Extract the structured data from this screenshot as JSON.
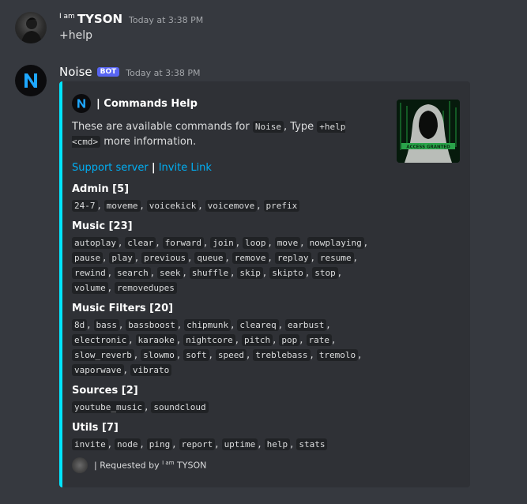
{
  "user_message": {
    "username_prefix": "I am",
    "username": "TYSON",
    "timestamp": "Today at 3:38 PM",
    "content": "+help"
  },
  "bot_message": {
    "botname": "Noise",
    "bot_tag": "BOT",
    "timestamp": "Today at 3:38 PM",
    "embed": {
      "accent_color": "#00e5ff",
      "author": "| Commands Help",
      "desc_pre": "These are available commands for ",
      "desc_code1": "Noise",
      "desc_mid": ", Type ",
      "desc_code2": "+help <cmd>",
      "desc_post": " more information.",
      "link_support": "Support server",
      "link_sep": "|",
      "link_invite": "Invite Link",
      "thumbnail_text": "ACCESS GRANTED",
      "fields": [
        {
          "title": "Admin [5]",
          "commands": [
            "24-7",
            "moveme",
            "voicekick",
            "voicemove",
            "prefix"
          ]
        },
        {
          "title": "Music [23]",
          "commands": [
            "autoplay",
            "clear",
            "forward",
            "join",
            "loop",
            "move",
            "nowplaying",
            "pause",
            "play",
            "previous",
            "queue",
            "remove",
            "replay",
            "resume",
            "rewind",
            "search",
            "seek",
            "shuffle",
            "skip",
            "skipto",
            "stop",
            "volume",
            "removedupes"
          ]
        },
        {
          "title": "Music Filters [20]",
          "commands": [
            "8d",
            "bass",
            "bassboost",
            "chipmunk",
            "cleareq",
            "earbust",
            "electronic",
            "karaoke",
            "nightcore",
            "pitch",
            "pop",
            "rate",
            "slow_reverb",
            "slowmo",
            "soft",
            "speed",
            "treblebass",
            "tremolo",
            "vaporwave",
            "vibrato"
          ]
        },
        {
          "title": "Sources [2]",
          "commands": [
            "youtube_music",
            "soundcloud"
          ]
        },
        {
          "title": "Utils [7]",
          "commands": [
            "invite",
            "node",
            "ping",
            "report",
            "uptime",
            "help",
            "stats"
          ]
        }
      ],
      "footer_pre": "| Requested by ",
      "footer_small": "I am",
      "footer_name": " TYSON"
    }
  }
}
